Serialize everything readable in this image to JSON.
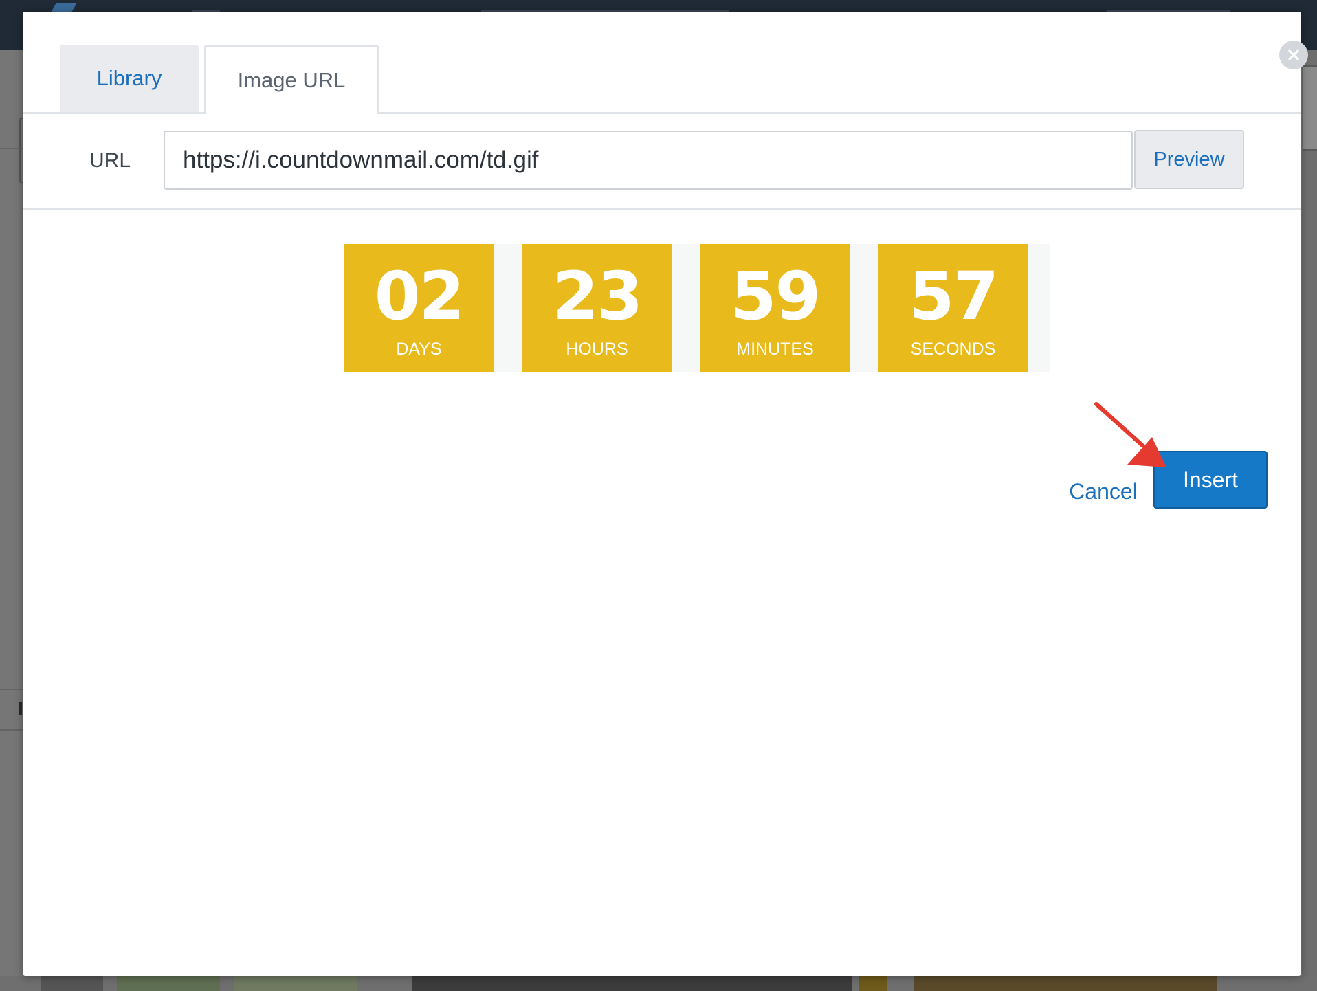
{
  "dialog": {
    "tabs": [
      {
        "label": "Library"
      },
      {
        "label": "Image URL"
      }
    ],
    "url_label": "URL",
    "url_value": "https://i.countdownmail.com/td.gif",
    "preview_label": "Preview",
    "cancel_label": "Cancel",
    "insert_label": "Insert",
    "close_icon": "close-icon"
  },
  "countdown": {
    "units": [
      {
        "value": "02",
        "label": "DAYS"
      },
      {
        "value": "23",
        "label": "HOURS"
      },
      {
        "value": "59",
        "label": "MINUTES"
      },
      {
        "value": "57",
        "label": "SECONDS"
      }
    ],
    "box_color": "#e9ba1c"
  },
  "colors": {
    "accent": "#1679c8",
    "link": "#1b6fbb",
    "annotation_arrow": "#e53a2f"
  }
}
